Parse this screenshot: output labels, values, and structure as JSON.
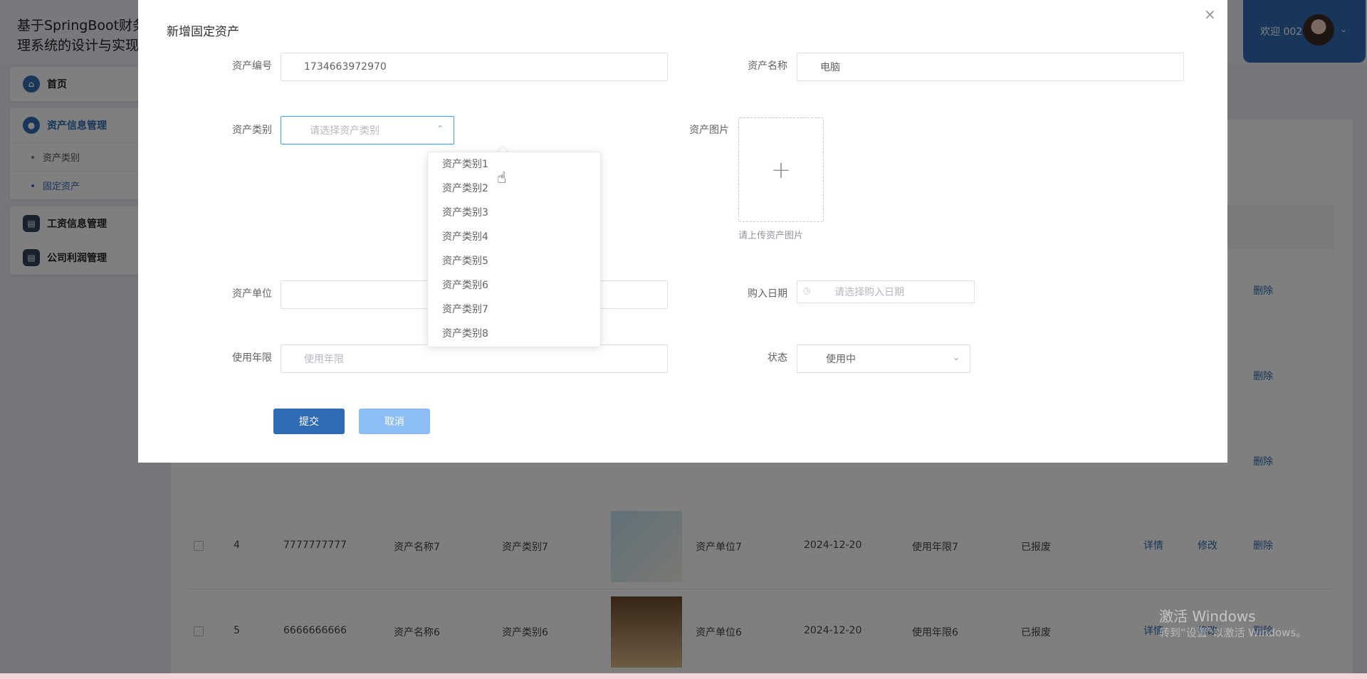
{
  "app": {
    "title_line1": "基于SpringBoot财务管",
    "title_line2": "理系统的设计与实现",
    "welcome": "欢迎 002"
  },
  "sidebar": {
    "home": "首页",
    "asset_mgmt": "资产信息管理",
    "asset_sub": [
      "资产类别",
      "固定资产"
    ],
    "salary_mgmt": "工资信息管理",
    "profit_mgmt": "公司利润管理"
  },
  "table": {
    "rows": [
      {
        "idx": "4",
        "code": "7777777777",
        "name": "资产名称7",
        "category": "资产类别7",
        "unit": "资产单位7",
        "date": "2024-12-20",
        "life": "使用年限7",
        "status": "已报废",
        "detail": "详情",
        "edit": "修改",
        "delete": "删除"
      },
      {
        "idx": "5",
        "code": "6666666666",
        "name": "资产名称6",
        "category": "资产类别6",
        "unit": "资产单位6",
        "date": "2024-12-20",
        "life": "使用年限6",
        "status": "已报废",
        "detail": "详情",
        "edit": "修改",
        "delete": "删除"
      }
    ],
    "delete_label": "删除"
  },
  "dialog": {
    "title": "新增固定资产",
    "fields": {
      "code_label": "资产编号",
      "code_value": "1734663972970",
      "name_label": "资产名称",
      "name_value": "电脑",
      "category_label": "资产类别",
      "category_placeholder": "请选择资产类别",
      "image_label": "资产图片",
      "image_tip": "请上传资产图片",
      "unit_label": "资产单位",
      "date_label": "购入日期",
      "date_placeholder": "请选择购入日期",
      "life_label": "使用年限",
      "life_placeholder": "使用年限",
      "status_label": "状态",
      "status_value": "使用中"
    },
    "submit": "提交",
    "cancel": "取消",
    "category_options": [
      "资产类别1",
      "资产类别2",
      "资产类别3",
      "资产类别4",
      "资产类别5",
      "资产类别6",
      "资产类别7",
      "资产类别8"
    ]
  },
  "watermark": {
    "line1": "激活 Windows",
    "line2": "转到“设置”以激活 Windows。"
  }
}
